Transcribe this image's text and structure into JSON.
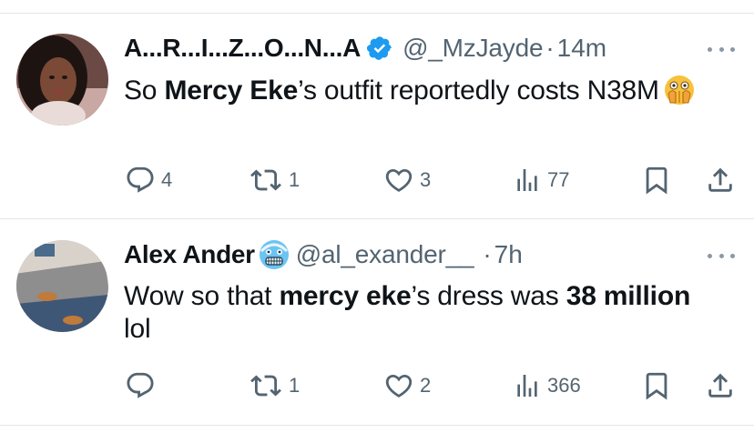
{
  "tweets": [
    {
      "name": "A...R...I...Z...O...N...A",
      "handle": "@_MzJayde",
      "separator": "·",
      "time": "14m",
      "text_parts": [
        {
          "text": "So ",
          "bold": false
        },
        {
          "text": "Mercy Eke",
          "bold": true
        },
        {
          "text": "’s outfit reportedly costs N38M",
          "bold": false
        }
      ],
      "badge_icon": "verified-badge-icon",
      "badge_color": "#1d9bf0",
      "emoji_icon": "face-with-open-eyes-and-hand-over-mouth-icon",
      "stats": {
        "replies": "4",
        "reposts": "1",
        "likes": "3",
        "views": "77"
      }
    },
    {
      "name": "Alex Ander",
      "handle": "@al_exander__",
      "separator": "·",
      "time": "7h",
      "text_parts": [
        {
          "text": "Wow so that ",
          "bold": false
        },
        {
          "text": "mercy eke",
          "bold": true
        },
        {
          "text": "’s dress was ",
          "bold": false
        },
        {
          "text": "38 million",
          "bold": true
        },
        {
          "text": " lol",
          "bold": false
        }
      ],
      "badge_icon": "cold-face-emoji-icon",
      "stats": {
        "replies": "",
        "reposts": "1",
        "likes": "2",
        "views": "366"
      }
    }
  ],
  "colors": {
    "text": "#0f1419",
    "secondary": "#536471",
    "divider": "#e3e6e9"
  }
}
